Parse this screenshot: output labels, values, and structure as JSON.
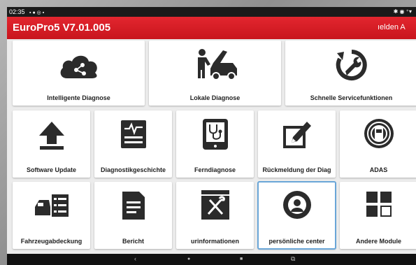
{
  "status": {
    "time": "02:35",
    "left_icons": "▪ ● ◎ ▪",
    "right_icons": "✱ ◉ ⁺▾"
  },
  "header": {
    "title": "EuroPro5 V7.01.005",
    "menu_text": "ıelden   A"
  },
  "tiles": [
    {
      "label": "Intelligente Diagnose",
      "icon": "cloud-share-icon"
    },
    {
      "label": "Lokale Diagnose",
      "icon": "mechanic-car-icon"
    },
    {
      "label": "Schnelle Servicefunktionen",
      "icon": "service-wrench-icon"
    },
    {
      "label": "Software Update",
      "icon": "upload-icon"
    },
    {
      "label": "Diagnostikgeschichte",
      "icon": "diagnostic-history-icon"
    },
    {
      "label": "Ferndiagnose",
      "icon": "remote-diagnosis-icon"
    },
    {
      "label": "Rückmeldung der Diag",
      "icon": "feedback-pencil-icon"
    },
    {
      "label": "ADAS",
      "icon": "adas-icon"
    },
    {
      "label": "Fahrzeugabdeckung",
      "icon": "vehicle-coverage-icon"
    },
    {
      "label": "Bericht",
      "icon": "report-icon"
    },
    {
      "label": "urinformationen",
      "icon": "repair-info-icon"
    },
    {
      "label": "persönliche center",
      "icon": "personal-center-icon"
    },
    {
      "label": "Andere Module",
      "icon": "other-modules-icon"
    }
  ],
  "navbar": {
    "back": "‹",
    "home": "●",
    "recents": "■",
    "screenshot": "⧉"
  }
}
